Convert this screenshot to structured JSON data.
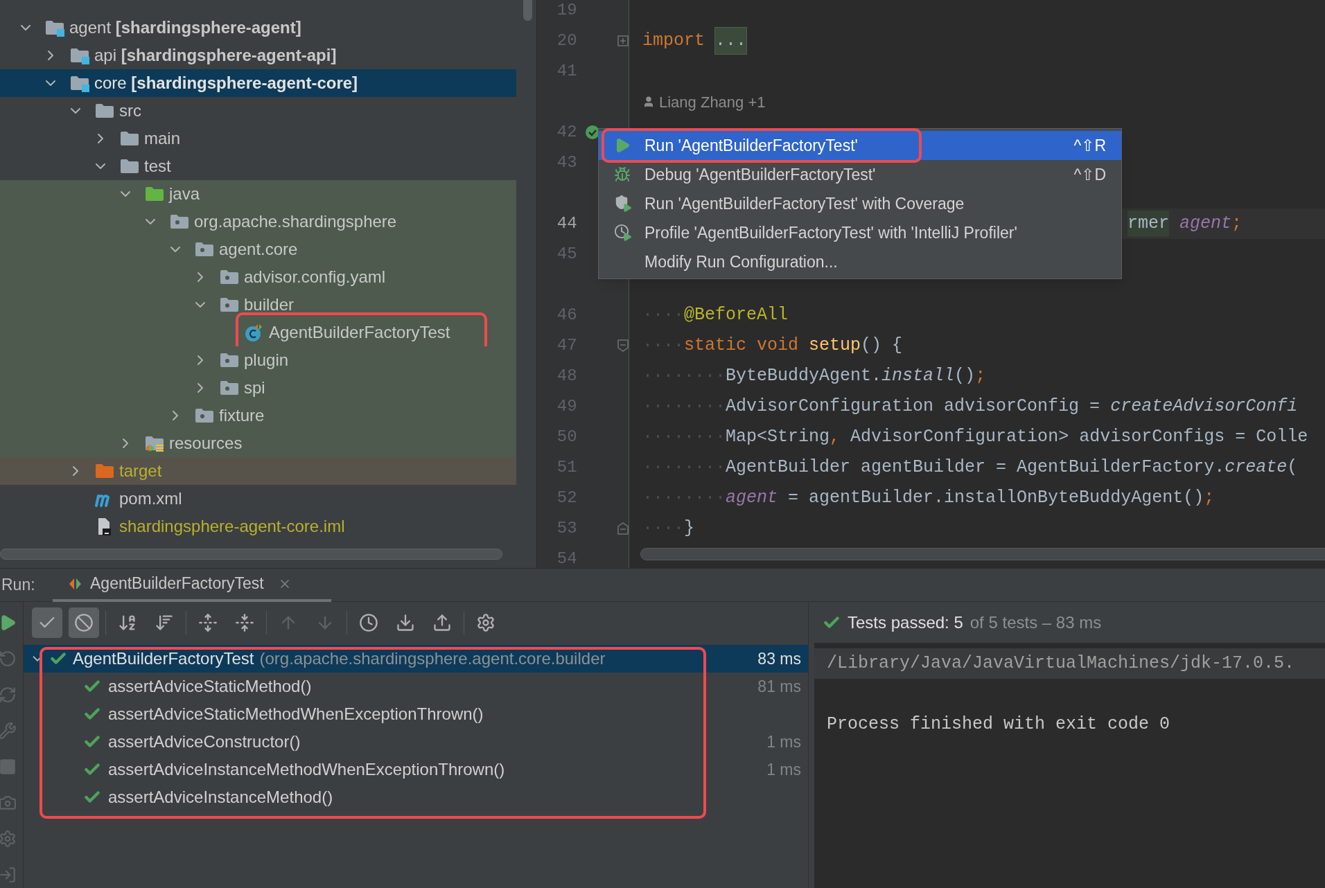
{
  "project_tree": {
    "items": [
      {
        "label": "agent **[shardingsphere-agent]**",
        "kind": "module",
        "expanded": true,
        "selected": false,
        "outlined": false,
        "children": [
          {
            "label": "api **[shardingsphere-agent-api]**",
            "kind": "module",
            "expanded": false,
            "selected": false,
            "outlined": false
          },
          {
            "label": "core **[shardingsphere-agent-core]**",
            "kind": "module",
            "expanded": true,
            "selected": true,
            "outlined": false,
            "children": [
              {
                "label": "src",
                "kind": "folder",
                "expanded": true,
                "selected": false,
                "outlined": false,
                "children": [
                  {
                    "label": "main",
                    "kind": "folder",
                    "expanded": false,
                    "selected": false,
                    "outlined": false
                  },
                  {
                    "label": "test",
                    "kind": "folder",
                    "expanded": true,
                    "selected": false,
                    "outlined": false,
                    "children": [
                      {
                        "label": "java",
                        "kind": "test_root",
                        "expanded": true,
                        "selected": false,
                        "outlined": false,
                        "children": [
                          {
                            "label": "org.apache.shardingsphere",
                            "kind": "package",
                            "expanded": true,
                            "selected": false,
                            "outlined": false,
                            "children": [
                              {
                                "label": "agent.core",
                                "kind": "package",
                                "expanded": true,
                                "selected": false,
                                "outlined": false,
                                "children": [
                                  {
                                    "label": "advisor.config.yaml",
                                    "kind": "package",
                                    "expanded": false,
                                    "selected": false,
                                    "outlined": false
                                  },
                                  {
                                    "label": "builder",
                                    "kind": "package",
                                    "expanded": true,
                                    "selected": false,
                                    "outlined": false,
                                    "children": [
                                      {
                                        "label": "AgentBuilderFactoryTest",
                                        "kind": "test_class",
                                        "selected": false,
                                        "outlined": true
                                      }
                                    ]
                                  },
                                  {
                                    "label": "plugin",
                                    "kind": "package",
                                    "expanded": false,
                                    "selected": false,
                                    "outlined": false
                                  },
                                  {
                                    "label": "spi",
                                    "kind": "package",
                                    "expanded": false,
                                    "selected": false,
                                    "outlined": false
                                  }
                                ]
                              },
                              {
                                "label": "fixture",
                                "kind": "package",
                                "expanded": false,
                                "selected": false,
                                "outlined": false
                              }
                            ]
                          }
                        ]
                      },
                      {
                        "label": "resources",
                        "kind": "test_resources",
                        "expanded": false,
                        "selected": false,
                        "outlined": false
                      }
                    ]
                  }
                ]
              },
              {
                "label": "target",
                "kind": "excluded",
                "expanded": false,
                "selected": false,
                "outlined": false
              },
              {
                "label": "pom.xml",
                "kind": "maven",
                "selected": false,
                "outlined": false
              },
              {
                "label": "shardingsphere-agent-core.iml",
                "kind": "module_file",
                "selected": false,
                "outlined": false
              }
            ]
          }
        ]
      }
    ]
  },
  "editor": {
    "lines": [
      {
        "kind": "code",
        "number": "19",
        "current": false
      },
      {
        "kind": "code",
        "number": "20",
        "current": false,
        "partly_hidden": false,
        "markers": [
          {
            "kind": "fold_collapsed"
          }
        ],
        "tokens": [
          {
            "text": "import ",
            "kind": "keyword"
          },
          {
            "text": "...",
            "kind": "folded"
          }
        ]
      },
      {
        "kind": "code",
        "number": "41",
        "current": false
      },
      {
        "kind": "author",
        "text": "Liang Zhang +1"
      },
      {
        "kind": "code",
        "number": "42",
        "current": false,
        "markers": [
          {
            "kind": "test_passed"
          }
        ]
      },
      {
        "kind": "code",
        "number": "43",
        "current": false
      },
      {
        "kind": "spacer"
      },
      {
        "kind": "code",
        "number": "44",
        "current": true,
        "partly_hidden": true,
        "tokens": [
          {
            "text": "rmer",
            "kind": "usage"
          },
          {
            "text": " agent",
            "kind": "field"
          },
          {
            "text": ";",
            "kind": "keyword"
          }
        ]
      },
      {
        "kind": "code",
        "number": "45",
        "current": false
      },
      {
        "kind": "spacer"
      },
      {
        "kind": "code",
        "number": "46",
        "current": false,
        "partly_hidden": false,
        "tokens": [
          {
            "text": "····",
            "kind": "whitespace"
          },
          {
            "text": "@BeforeAll",
            "kind": "annotation"
          }
        ]
      },
      {
        "kind": "code",
        "number": "47",
        "current": false,
        "partly_hidden": false,
        "markers": [
          {
            "kind": "fold_start"
          }
        ],
        "tokens": [
          {
            "text": "····",
            "kind": "whitespace"
          },
          {
            "text": "static void ",
            "kind": "keyword"
          },
          {
            "text": "setup",
            "kind": "declaration"
          },
          {
            "text": "() {",
            "kind": "plain"
          }
        ]
      },
      {
        "kind": "code",
        "number": "48",
        "current": false,
        "partly_hidden": false,
        "tokens": [
          {
            "text": "········",
            "kind": "whitespace"
          },
          {
            "text": "ByteBuddyAgent.",
            "kind": "plain"
          },
          {
            "text": "install",
            "kind": "static_call"
          },
          {
            "text": "()",
            "kind": "plain"
          },
          {
            "text": ";",
            "kind": "keyword"
          }
        ]
      },
      {
        "kind": "code",
        "number": "49",
        "current": false,
        "partly_hidden": false,
        "tokens": [
          {
            "text": "········",
            "kind": "whitespace"
          },
          {
            "text": "AdvisorConfiguration advisorConfig = ",
            "kind": "plain"
          },
          {
            "text": "createAdvisorConfi",
            "kind": "static_call"
          }
        ]
      },
      {
        "kind": "code",
        "number": "50",
        "current": false,
        "partly_hidden": false,
        "tokens": [
          {
            "text": "········",
            "kind": "whitespace"
          },
          {
            "text": "Map<String",
            "kind": "plain"
          },
          {
            "text": ",",
            "kind": "keyword"
          },
          {
            "text": " AdvisorConfiguration> advisorConfigs = Colle",
            "kind": "plain"
          }
        ]
      },
      {
        "kind": "code",
        "number": "51",
        "current": false,
        "partly_hidden": false,
        "tokens": [
          {
            "text": "········",
            "kind": "whitespace"
          },
          {
            "text": "AgentBuilder agentBuilder = AgentBuilderFactory.",
            "kind": "plain"
          },
          {
            "text": "create",
            "kind": "static_call"
          },
          {
            "text": "(",
            "kind": "plain"
          }
        ]
      },
      {
        "kind": "code",
        "number": "52",
        "current": false,
        "partly_hidden": false,
        "tokens": [
          {
            "text": "········",
            "kind": "whitespace"
          },
          {
            "text": "agent",
            "kind": "field"
          },
          {
            "text": " = agentBuilder.installOnByteBuddyAgent()",
            "kind": "plain"
          },
          {
            "text": ";",
            "kind": "keyword"
          }
        ]
      },
      {
        "kind": "code",
        "number": "53",
        "current": false,
        "partly_hidden": false,
        "markers": [
          {
            "kind": "fold_end"
          }
        ],
        "tokens": [
          {
            "text": "····",
            "kind": "whitespace"
          },
          {
            "text": "}",
            "kind": "plain"
          }
        ]
      },
      {
        "kind": "code",
        "number": "54",
        "current": false
      }
    ]
  },
  "context_menu": {
    "items": [
      {
        "label": "Run 'AgentBuilderFactoryTest'",
        "kind": "run",
        "shortcut": "^⇧R",
        "selected": true,
        "outlined": true
      },
      {
        "label": "Debug 'AgentBuilderFactoryTest'",
        "kind": "debug",
        "shortcut": "^⇧D",
        "selected": false,
        "outlined": false
      },
      {
        "label": "Run 'AgentBuilderFactoryTest' with Coverage",
        "kind": "coverage",
        "selected": false,
        "outlined": false
      },
      {
        "label": "Profile 'AgentBuilderFactoryTest' with 'IntelliJ Profiler'",
        "kind": "profiler",
        "selected": false,
        "outlined": false
      },
      {
        "label": "Modify Run Configuration...",
        "selected": false,
        "outlined": false
      }
    ]
  },
  "run_panel": {
    "label": "Run:",
    "tabs": [
      {
        "label": "AgentBuilderFactoryTest",
        "selected": true
      }
    ],
    "side_tools": [
      {
        "kind": "run",
        "disabled": false
      },
      {
        "kind": "rerun_failed",
        "disabled": true
      },
      {
        "kind": "auto_test",
        "disabled": true
      },
      {
        "kind": "wrench",
        "disabled": true
      },
      {
        "kind": "stop",
        "disabled": true
      },
      {
        "kind": "snapshot",
        "disabled": true
      },
      {
        "kind": "settings",
        "disabled": true
      },
      {
        "kind": "exit",
        "disabled": true
      }
    ],
    "toolbar": [
      {
        "kind": "show_passed",
        "on": true,
        "disabled": false
      },
      {
        "kind": "show_ignored",
        "on": true,
        "disabled": false
      },
      {
        "kind": "sort_alpha",
        "on": false,
        "disabled": false
      },
      {
        "kind": "sort_duration",
        "on": false,
        "disabled": false
      },
      {
        "kind": "expand_all",
        "on": false,
        "disabled": false
      },
      {
        "kind": "collapse_all",
        "on": false,
        "disabled": false
      },
      {
        "kind": "previous",
        "on": false,
        "disabled": true
      },
      {
        "kind": "next",
        "on": false,
        "disabled": true
      },
      {
        "kind": "history",
        "on": false,
        "disabled": false
      },
      {
        "kind": "import",
        "on": false,
        "disabled": false
      },
      {
        "kind": "export",
        "on": false,
        "disabled": false
      },
      {
        "kind": "settings",
        "on": false,
        "disabled": false
      }
    ],
    "status": {
      "summary": "Tests passed: 5",
      "detail": "of 5 tests – 83 ms"
    },
    "results": {
      "outlined": true,
      "root": {
        "name": "AgentBuilderFactoryTest",
        "package": "(org.apache.shardingsphere.agent.core.builder",
        "duration": "83 ms",
        "passed": true,
        "selected": true,
        "expanded": true
      },
      "tests": [
        {
          "name": "assertAdviceStaticMethod()",
          "duration": "81 ms",
          "passed": true,
          "selected": false
        },
        {
          "name": "assertAdviceStaticMethodWhenExceptionThrown()",
          "passed": true,
          "selected": false
        },
        {
          "name": "assertAdviceConstructor()",
          "duration": "1 ms",
          "passed": true,
          "selected": false
        },
        {
          "name": "assertAdviceInstanceMethodWhenExceptionThrown()",
          "duration": "1 ms",
          "passed": true,
          "selected": false
        },
        {
          "name": "assertAdviceInstanceMethod()",
          "passed": true,
          "selected": false
        }
      ]
    },
    "console": {
      "lines": [
        {
          "kind": "output",
          "text": "/Library/Java/JavaVirtualMachines/jdk-17.0.5.",
          "highlighted": true
        },
        {
          "kind": "blank"
        },
        {
          "kind": "output",
          "text": "Process finished with exit code 0",
          "highlighted": false
        }
      ]
    }
  }
}
